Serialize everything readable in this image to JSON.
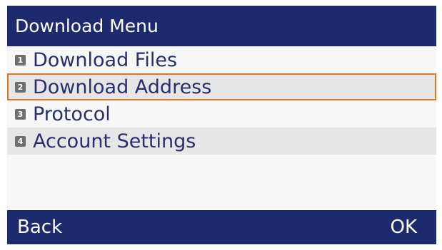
{
  "header": {
    "title": "Download Menu"
  },
  "menu": {
    "items": [
      {
        "number": "1",
        "label": "Download Files",
        "selected": false
      },
      {
        "number": "2",
        "label": "Download Address",
        "selected": true
      },
      {
        "number": "3",
        "label": "Protocol",
        "selected": false
      },
      {
        "number": "4",
        "label": "Account Settings",
        "selected": false
      }
    ]
  },
  "softkeys": {
    "left_label": "Back",
    "right_label": "OK"
  },
  "colors": {
    "title_bar": "#1e2a6e",
    "selection_border": "#e8731c",
    "text": "#2a2f6b"
  }
}
